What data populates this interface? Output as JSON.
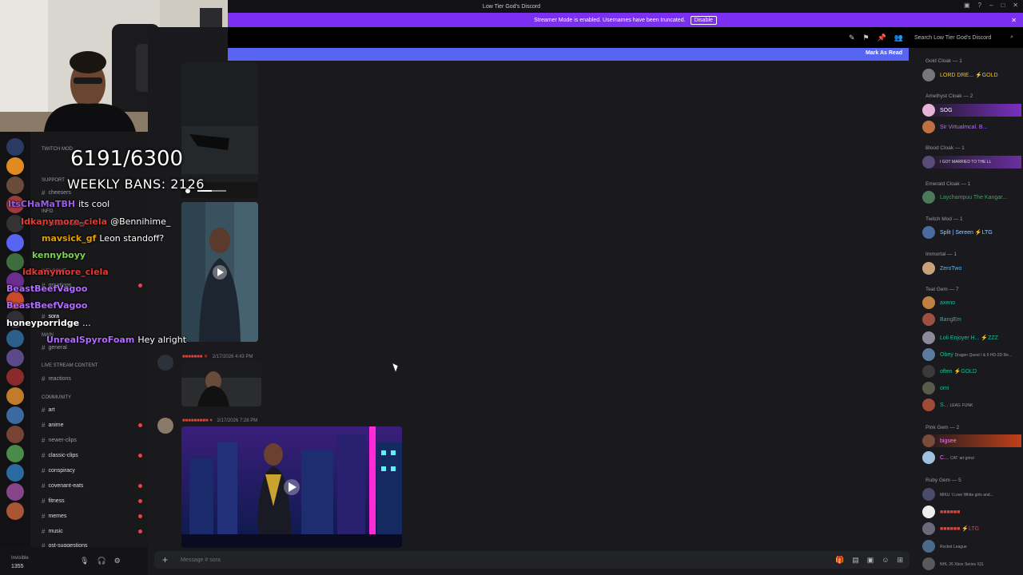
{
  "window": {
    "title": "Low Tier God's Discord",
    "streamer_notice": "Streamer Mode is enabled. Usernames have been truncated.",
    "disable_label": "Disable"
  },
  "toolbar": {
    "search_placeholder": "Search Low Tier God's Discord",
    "new_messages_mark": "Mark As Read"
  },
  "overlay": {
    "counter": "6191/6300",
    "weekly_bans": "WEEKLY BANS: 2126"
  },
  "stream_chat": [
    {
      "user": "ItsCHaMaTBH",
      "text": "its cool",
      "color": "#9b5de5"
    },
    {
      "user": "Idkanymore_ciela",
      "text": "@Bennihime_",
      "color": "#e53935"
    },
    {
      "user": "mavsick_gf",
      "text": "Leon standoff?",
      "color": "#e5a000"
    },
    {
      "user": "kennyboyy",
      "text": "",
      "color": "#7cd34f"
    },
    {
      "user": "idkanymore_ciela",
      "text": "",
      "color": "#e53935"
    },
    {
      "user": "BeastBeefVagoo",
      "text": "",
      "color": "#b36bff"
    },
    {
      "user": "BeastBeefVagoo",
      "text": "",
      "color": "#b36bff"
    },
    {
      "user": "honeyporridge",
      "text": "...",
      "color": "#ffffff"
    },
    {
      "user": "UnrealSpyroFoam",
      "text": "Hey alright",
      "color": "#b36bff"
    }
  ],
  "channels": {
    "categories": {
      "twitch": "TWITCH MOD",
      "support": "SUPPORT",
      "info": "INFO",
      "welcome": "WELCOME",
      "main": "MAIN",
      "live": "LIVE STREAM CONTENT",
      "community": "COMMUNITY"
    },
    "items": {
      "cheesers": "cheesers",
      "stream_notices": "stream-notices",
      "greetings": "greetings",
      "sora": "sora",
      "general": "general",
      "reactions": "reactions",
      "art": "art",
      "anime": "anime",
      "newer_clips": "newer-clips",
      "classic_clips": "classic-clips",
      "conspiracy": "conspiracy",
      "covenant_eats": "covenant-eats",
      "fitness": "fitness",
      "memes": "memes",
      "music": "music",
      "ost_suggestions": "ost-suggestions"
    }
  },
  "user_panel": {
    "status": "Invisible",
    "count": "1355"
  },
  "messages": [
    {
      "timestamp": "2/17/2026 4:43 PM"
    },
    {
      "timestamp": "2/17/2026 7:28 PM"
    }
  ],
  "composer": {
    "placeholder": "Message #",
    "channel": "sora"
  },
  "members": {
    "roles": {
      "gold": "Gold Cloak — 1",
      "amethyst": "Amethyst Cloak — 2",
      "blood": "Blood Cloak — 1",
      "emerald": "Emerald Cloak — 1",
      "twitch": "Twitch Mod — 1",
      "immortal": "Immortal — 1",
      "teal": "Teal Gem — 7",
      "pink": "Pink Gem — 2",
      "ruby": "Ruby Gem — 5"
    },
    "list": {
      "lord": "LORD DRE...",
      "gold_tag": "GOLD",
      "sog": "SOG",
      "sir": "Sir Virtualmcal. B...",
      "married": "I GOT MARRIED TO THE LL",
      "lay": "Laychampuu The Kangar...",
      "split": "Split | Sereen",
      "ltg": "LTG",
      "zerotwo": "ZeroTwo",
      "axeno": "axeno",
      "bangem": "BangEm",
      "loli": "Loli Enjoyer H...",
      "zzz": "ZZZ",
      "obey": "Obey",
      "dragon": "Dragon Quest I & II HD-2D Re...",
      "often": "often",
      "omi": "omi",
      "s": "S...",
      "leag": "LEAG",
      "funk": "FUNK",
      "bigsee": "bigsee",
      "c": "C...",
      "cat": "CAT",
      "art_grind": "art grind",
      "mikki": "MIKU",
      "love_girls": "I Love White girls and...",
      "rocket": "Rocket League",
      "nhl": "NHL 26 Xbox Series X|S"
    }
  },
  "colors": {
    "accent": "#5865f2",
    "streamer_bar": "#7b2ff0",
    "unread": "#f23f43"
  }
}
